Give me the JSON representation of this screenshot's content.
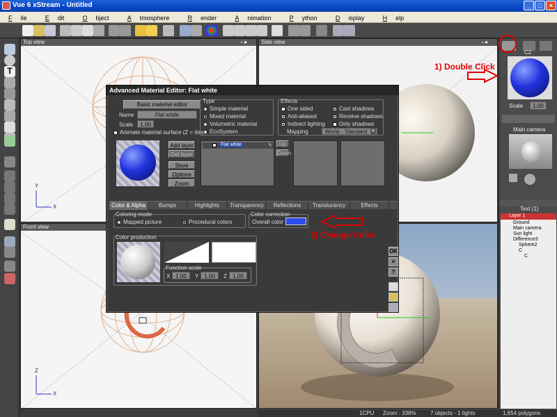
{
  "window": {
    "title": "Vue 6 xStream - Untitled",
    "minimize": "_",
    "maximize": "□",
    "close": "×"
  },
  "menu": [
    {
      "u": "F",
      "rest": "ile"
    },
    {
      "u": "E",
      "rest": "dit"
    },
    {
      "u": "O",
      "rest": "bject"
    },
    {
      "u": "A",
      "rest": "tmosphere"
    },
    {
      "u": "R",
      "rest": "ender"
    },
    {
      "u": "A",
      "rest": "nimation"
    },
    {
      "u": "P",
      "rest": "ython"
    },
    {
      "u": "D",
      "rest": "isplay"
    },
    {
      "u": "H",
      "rest": "elp"
    }
  ],
  "viewports": {
    "top": {
      "title": "Top view",
      "controls": "▪ ■"
    },
    "side": {
      "title": "Side view",
      "controls": "▪ ■"
    },
    "front": {
      "title": "Front view",
      "controls": "▪ ■"
    },
    "axis": {
      "x": "X",
      "y": "Y",
      "z": "Z"
    }
  },
  "right_panel": {
    "material_name": "C2",
    "scale_label": "Scale",
    "scale_value": "1.00",
    "camera_label": "Main camera",
    "tree_header": "Text (1)",
    "layer_label": "Layer 1",
    "tree_items": [
      "Ground",
      "Main camera",
      "Sun light",
      "Difference3",
      "Sphere2",
      "C",
      "C"
    ]
  },
  "dialog": {
    "title": "Advanced Material Editor: Flat white",
    "basic_button": "Basic material editor",
    "name_label": "Name",
    "name_value": "Flat white",
    "scale_label": "Scale",
    "scale_value": "1.00",
    "animate_label": "Animate material surface (Z = time)",
    "type": {
      "title": "Type",
      "options": [
        "Simple material",
        "Mixed material",
        "Volumetric material",
        "EcoSystem"
      ],
      "selected": 1
    },
    "effects": {
      "title": "Effects",
      "left": [
        {
          "label": "One sided",
          "checked": false
        },
        {
          "label": "Anti-aliased",
          "checked": true
        },
        {
          "label": "Indirect lighting",
          "checked": true
        }
      ],
      "right": [
        {
          "label": "Cast shadows",
          "checked": true
        },
        {
          "label": "Receive shadows",
          "checked": true
        },
        {
          "label": "Only shadows",
          "checked": false
        }
      ],
      "mapping_label": "Mapping",
      "mapping_value": "World - Standard"
    },
    "layer_buttons": [
      "Add layer",
      "Del layer",
      "Store",
      "Options",
      "Zoom"
    ],
    "layer_item": "Flat white",
    "up_label": "Up",
    "down_label": "Down",
    "tabs": [
      "Color & Alpha",
      "Bumps",
      "Highlights",
      "Transparency",
      "Reflections",
      "Translucency",
      "Effects"
    ],
    "active_tab": 0,
    "coloring_mode": {
      "title": "Coloring mode",
      "options": [
        "Mapped picture",
        "Procedural colors"
      ],
      "selected": 1
    },
    "color_correction": {
      "title": "Color correction",
      "overall_label": "Overall color",
      "overall_color": "#2f4cf0"
    },
    "color_production_title": "Color production",
    "function_scale": {
      "title": "Function scale",
      "x_label": "X",
      "x": "1.00",
      "y_label": "Y",
      "y": "1.00",
      "z_label": "Z",
      "z": "1.00"
    },
    "side_buttons": [
      "OK",
      "×",
      "?"
    ]
  },
  "annotations": {
    "step1": "1) Double Click",
    "step2": "2) Change Color"
  },
  "status": {
    "cpu": "1CPU",
    "zoom": "Zoom : 338%",
    "objects": "7 objects - 1 lights",
    "polygons": "1,654 polygons"
  },
  "colors": {
    "accent_red": "#e00000",
    "sphere_blue": "#2233dd"
  }
}
